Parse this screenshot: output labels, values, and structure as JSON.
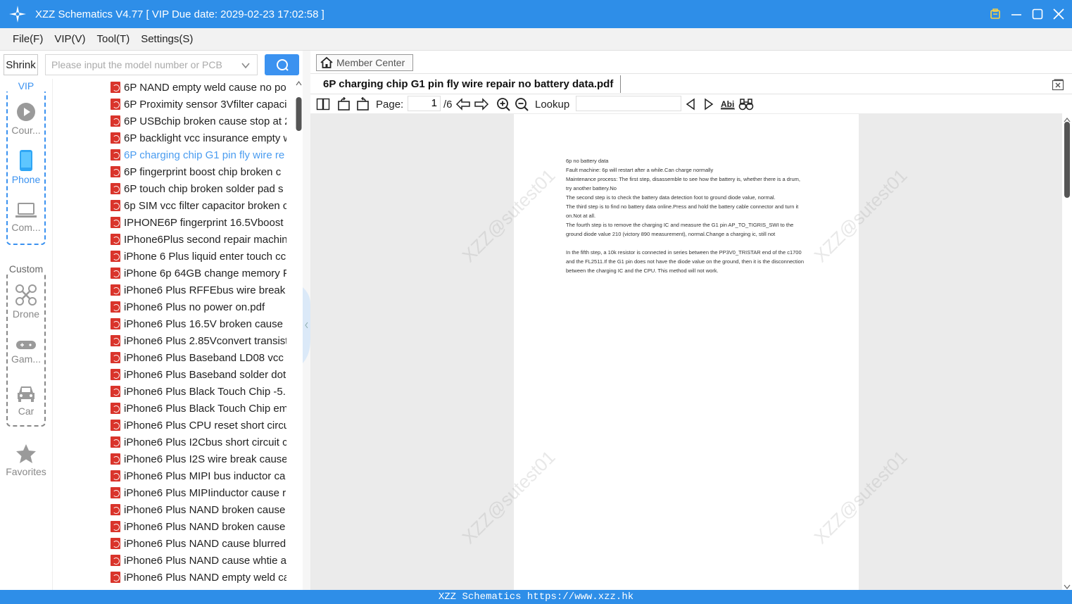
{
  "window": {
    "title": "XZZ Schematics V4.77 [ VIP Due date: 2029-02-23 17:02:58 ]",
    "accent": "#2e8ee8"
  },
  "menu": [
    "File(F)",
    "VIP(V)",
    "Tool(T)",
    "Settings(S)"
  ],
  "search": {
    "shrink_label": "Shrink",
    "placeholder": "Please input the model number or PCB"
  },
  "nav": {
    "vip_label": "VIP",
    "custom_label": "Custom",
    "items": [
      {
        "label": "Cour...",
        "icon": "play-circle-icon"
      },
      {
        "label": "Phone",
        "icon": "phone-icon"
      },
      {
        "label": "Com...",
        "icon": "laptop-icon"
      },
      {
        "label": "Drone",
        "icon": "drone-icon"
      },
      {
        "label": "Gam...",
        "icon": "gamepad-icon"
      },
      {
        "label": "Car",
        "icon": "car-icon"
      },
      {
        "label": "Favorites",
        "icon": "star-icon"
      }
    ]
  },
  "files": [
    "6P NAND empty weld cause no po",
    "6P Proximity sensor 3Vfilter capaci",
    "6P USBchip broken cause stop at 2",
    "6P backlight vcc insurance empty w",
    "6P charging chip G1 pin fly wire re",
    "6P fingerprint boost chip broken c",
    "6P touch chip broken solder pad s",
    "6p SIM vcc filter capacitor broken c",
    "IPHONE6P fingerprint 16.5Vboost c",
    "IPhone6Plus second repair machin",
    "iPhone 6 Plus liquid enter touch cc",
    "iPhone 6p 64GB change memory F",
    "iPhone6 Plus  RFFEbus wire break",
    "iPhone6 Plus  no power on.pdf",
    "iPhone6 Plus 16.5V broken cause r",
    "iPhone6 Plus 2.85Vconvert transist",
    "iPhone6 Plus Baseband LD08 vcc s",
    "iPhone6 Plus Baseband solder dot",
    "iPhone6 Plus Black Touch Chip -5.",
    "iPhone6 Plus Black Touch Chip em",
    "iPhone6 Plus CPU reset short circu",
    "iPhone6 Plus I2Cbus short circuit c",
    "iPhone6 Plus I2S wire break  cause",
    "iPhone6 Plus MIPI bus inductor ca",
    "iPhone6 Plus MIPIinductor cause r",
    "iPhone6 Plus NAND broken cause",
    "iPhone6 Plus NAND broken cause",
    "iPhone6 Plus NAND cause blurred",
    "iPhone6 Plus NAND cause whtie a",
    "iPhone6 Plus NAND empty weld ca"
  ],
  "selected_file_index": 4,
  "viewer": {
    "member_center": "Member Center",
    "tab_title": "6P charging chip G1 pin fly wire repair no battery data.pdf",
    "page_label": "Page:",
    "page_current": "1",
    "page_total": "/6",
    "lookup_label": "Lookup",
    "lookup_value": ""
  },
  "document": {
    "lines": [
      "6p no battery data",
      "Fault machine: 6p will restart after a while.Can charge normally",
      "Maintenance process: The first step, disassemble to see how the battery is, whether there is a drum, try another battery.No",
      "The second step is to check the battery data detection foot to ground diode value, normal.",
      "The third step is to find no battery data online.Press and hold the battery cable connector and turn it on.Not at all.",
      "The fourth step is to remove the charging IC and measure the G1 pin AP_TO_TIGRIS_SWI to the ground diode value 210 (victory 890 measurement), normal.Change a charging ic, still not",
      "In the fifth step, a 10k resistor is connected in series between the PP3V0_TRISTAR end of the c1700 and the FL2511.If the G1 pin does not have the diode value on the ground, then it is the disconnection between the charging IC and the CPU. This method will not work."
    ],
    "watermark": "XZZ@sutest01"
  },
  "status": "XZZ Schematics https://www.xzz.hk"
}
